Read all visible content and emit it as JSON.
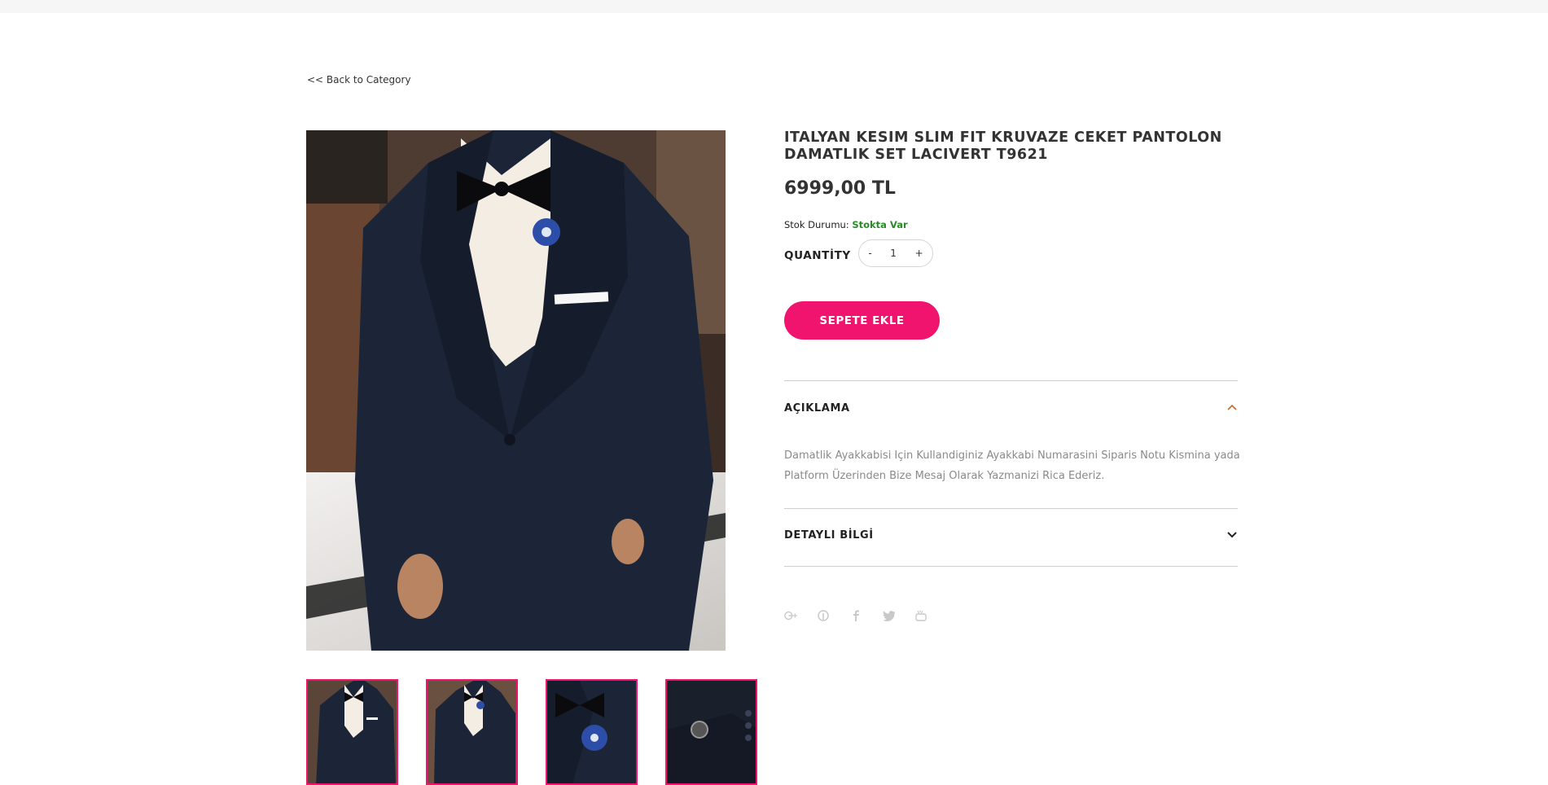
{
  "nav": {
    "back_label": "<< Back to Category"
  },
  "product": {
    "title": "ITALYAN KESIM SLIM FIT KRUVAZE CEKET PANTOLON DAMATLIK SET LACIVERT T9621",
    "price": "6999,00 TL",
    "stock_label": "Stok Durumu:",
    "stock_value": "Stokta Var",
    "quantity_label": "QUANTİTY",
    "quantity_value": "1",
    "qty_minus": "-",
    "qty_plus": "+",
    "add_to_cart_label": "SEPETE EKLE"
  },
  "accordion": {
    "description_title": "AÇIKLAMA",
    "description_text": "Damatlik Ayakkabisi Için Kullandiginiz Ayakkabi Numarasini Siparis Notu Kismina yada Platform Üzerinden Bize Mesaj Olarak Yazmanizi Rica Ederiz.",
    "details_title": "DETAYLI BİLGİ"
  },
  "social_icons": [
    "google-plus-icon",
    "pinterest-icon",
    "facebook-icon",
    "twitter-icon",
    "youtube-icon"
  ],
  "thumbnails": [
    "full-suit",
    "full-suit-front",
    "boutonniere-closeup",
    "sleeve-watch-closeup"
  ],
  "colors": {
    "accent": "#f0146e",
    "in_stock": "#2a8a2a",
    "suit_navy": "#1c2538"
  }
}
